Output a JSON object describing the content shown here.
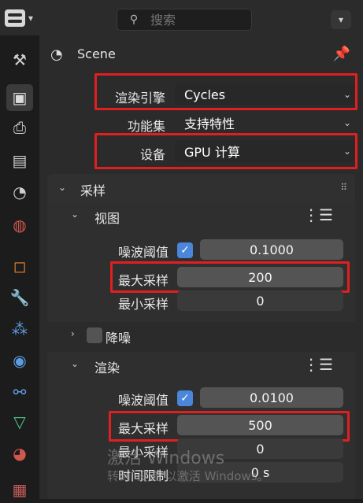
{
  "top": {
    "search_placeholder": "搜索",
    "editor_chevron": "▾",
    "dropdown_chevron": "▾"
  },
  "header": {
    "scene": "Scene"
  },
  "render": {
    "engine_label": "渲染引擎",
    "engine_value": "Cycles",
    "feature_label": "功能集",
    "feature_value": "支持特性",
    "device_label": "设备",
    "device_value": "GPU 计算"
  },
  "sampling": {
    "title": "采样",
    "viewport": {
      "title": "视图",
      "noise_threshold_label": "噪波阈值",
      "noise_threshold_value": "0.1000",
      "max_samples_label": "最大采样",
      "max_samples_value": "200",
      "min_samples_label": "最小采样",
      "min_samples_value": "0"
    },
    "denoise_label": "降噪",
    "render": {
      "title": "渲染",
      "noise_threshold_label": "噪波阈值",
      "noise_threshold_value": "0.0100",
      "max_samples_label": "最大采样",
      "max_samples_value": "500",
      "min_samples_label": "最小采样",
      "min_samples_value": "0",
      "time_limit_label": "时间限制",
      "time_limit_value": "0 s"
    }
  },
  "watermark": {
    "line1": "激活 Windows",
    "line2": "转到\"设置\"以激活 Windows。"
  },
  "glyphs": {
    "chev_down": "⌄",
    "chev_right": "›",
    "check": "✓",
    "list": "⋮☰",
    "grip": "⠿"
  }
}
